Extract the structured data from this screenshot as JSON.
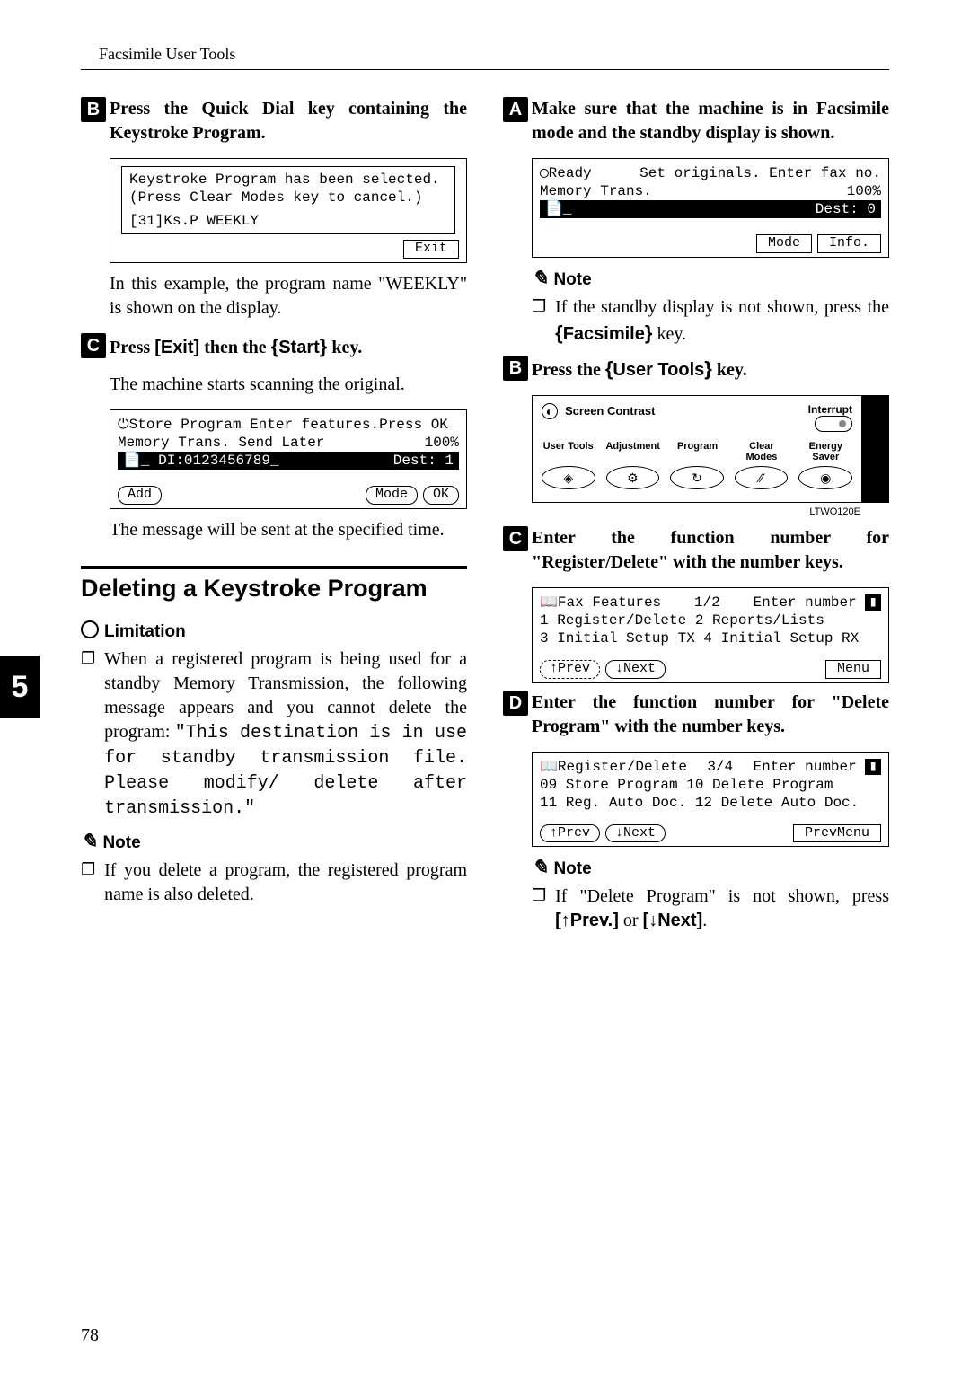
{
  "header": {
    "title": "Facsimile User Tools"
  },
  "sideTab": "5",
  "pageNumber": "78",
  "left": {
    "stepB": {
      "text": "Press the Quick Dial key containing the Keystroke Program."
    },
    "lcd1": {
      "line1": "Keystroke Program has been selected.",
      "line2": "(Press Clear Modes key to cancel.)",
      "line3": "[31]Ks.P WEEKLY",
      "btnExit": "Exit"
    },
    "para1": "In this example, the program name \"WEEKLY\" is shown on the display.",
    "stepC": {
      "pre": "Press ",
      "exit": "[Exit]",
      "mid": " then the ",
      "startKey": "Start",
      "post": " key."
    },
    "para2": "The machine starts scanning the original.",
    "lcd2": {
      "row1a": "⏻Store Program  Enter features.Press OK",
      "row2a": "Memory Trans. Send Later",
      "row2b": "100%",
      "row3a": "📄_ DI:0123456789_",
      "row3b": "Dest:  1",
      "btnAdd": "Add",
      "btnMode": "Mode",
      "btnOK": "OK"
    },
    "para3": "The message will be sent at the specified time.",
    "sectionHeading": "Deleting a Keystroke Program",
    "limitationLabel": "Limitation",
    "limitationBody": {
      "pre": "When a registered program is being used for a standby Memory Transmission, the following message appears and you cannot delete the program: ",
      "mono": "\"This destination is in use for standby transmission file. Please modify/ delete after transmission.\""
    },
    "noteLabel": "Note",
    "noteBody": "If you delete a program, the registered program name is also deleted."
  },
  "right": {
    "stepA": "Make sure that the machine is in Facsimile mode and the standby display is shown.",
    "lcdReady": {
      "row1a": "◯Ready",
      "row1b": "Set originals. Enter fax no.",
      "row2a": "Memory Trans.",
      "row2b": "100%",
      "row3a": "📄_",
      "row3b": "Dest:  0",
      "btnMode": "Mode",
      "btnInfo": "Info."
    },
    "noteLabel1": "Note",
    "noteBody1": {
      "pre": "If the standby display is not shown, press the ",
      "key": "Facsimile",
      "post": " key."
    },
    "stepB": {
      "pre": "Press the ",
      "key": "User Tools",
      "post": " key."
    },
    "panel": {
      "screenContrast": "Screen Contrast",
      "interrupt": "Interrupt",
      "labels": [
        "User Tools",
        "Adjustment",
        "Program",
        "Clear Modes",
        "Energy Saver"
      ],
      "caption": "LTWO120E"
    },
    "stepC": "Enter the function number for \"Register/Delete\" with the number keys.",
    "lcdFax": {
      "row1a": "📖Fax Features",
      "row1b": "1/2",
      "row1c": "Enter number ",
      "row2": "1 Register/Delete   2 Reports/Lists",
      "row3": "3 Initial Setup TX  4 Initial Setup RX",
      "btnPrev": "↑Prev",
      "btnNext": "↓Next",
      "btnMenu": "Menu"
    },
    "stepD": "Enter the function number for \"Delete Program\" with the number keys.",
    "lcdReg": {
      "row1a": "📖Register/Delete",
      "row1b": "3/4",
      "row1c": "Enter number ",
      "row2": "09 Store Program    10 Delete Program",
      "row3": "11 Reg. Auto Doc.   12 Delete Auto Doc.",
      "btnPrev": "↑Prev",
      "btnNext": "↓Next",
      "btnMenu": "PrevMenu"
    },
    "noteLabel2": "Note",
    "noteBody2": {
      "pre": "If \"Delete Program\" is not shown, press ",
      "k1": "[↑Prev.]",
      "mid": " or ",
      "k2": "[↓Next]",
      "post": "."
    }
  }
}
